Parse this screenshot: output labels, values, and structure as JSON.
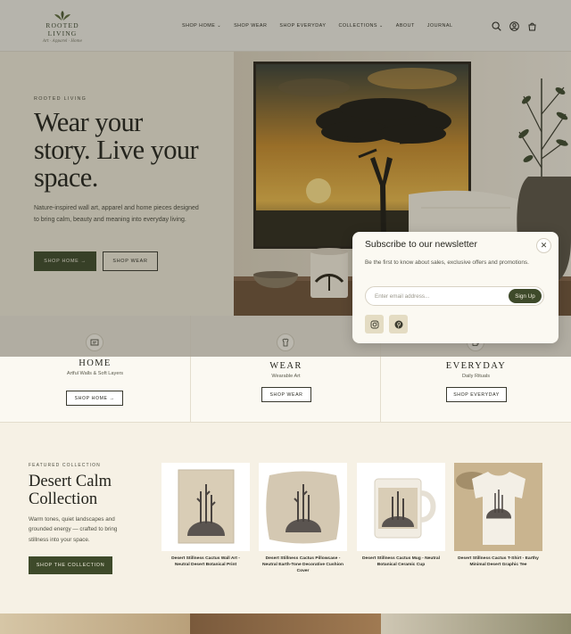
{
  "brand": {
    "name": "ROOTED LIVING",
    "tagline": "Art · Apparel · Home"
  },
  "nav": [
    {
      "label": "SHOP HOME",
      "caret": "⌄"
    },
    {
      "label": "SHOP WEAR",
      "caret": ""
    },
    {
      "label": "SHOP EVERYDAY",
      "caret": ""
    },
    {
      "label": "COLLECTIONS",
      "caret": "⌄"
    },
    {
      "label": "ABOUT",
      "caret": ""
    },
    {
      "label": "JOURNAL",
      "caret": ""
    }
  ],
  "header_icons": [
    "search-icon",
    "account-icon",
    "cart-icon"
  ],
  "hero": {
    "eyebrow": "ROOTED LIVING",
    "title_lines": [
      "Wear your",
      "story. Live your",
      "space."
    ],
    "description": "Nature-inspired wall art, apparel and home pieces designed to bring calm, beauty and meaning into everyday living.",
    "primary_button": "SHOP HOME →",
    "secondary_button": "SHOP WEAR"
  },
  "categories": [
    {
      "title": "HOME",
      "subtitle": "Artful Walls & Soft Layers",
      "button": "SHOP HOME →",
      "icon": "frame-icon"
    },
    {
      "title": "WEAR",
      "subtitle": "Wearable Art",
      "button": "SHOP WEAR",
      "icon": "shirt-icon"
    },
    {
      "title": "EVERYDAY",
      "subtitle": "Daily Rituals",
      "button": "SHOP EVERYDAY",
      "icon": "mug-icon"
    }
  ],
  "featured": {
    "eyebrow": "FEATURED COLLECTION",
    "title_lines": [
      "Desert Calm",
      "Collection"
    ],
    "description": "Warm tones, quiet landscapes and grounded energy — crafted to bring stillness into your space.",
    "button": "SHOP THE COLLECTION",
    "products": [
      {
        "name": "Desert Stillness Cactus Wall Art - Neutral Desert Botanical Print",
        "image": "wall-art-print"
      },
      {
        "name": "Desert Stillness Cactus Pillowcase - Neutral Earth-Tone Decorative Cushion Cover",
        "image": "pillow"
      },
      {
        "name": "Desert Stillness Cactus Mug - Neutral Botanical Ceramic Cup",
        "image": "mug"
      },
      {
        "name": "Desert Stillness Cactus T-Shirt - Earthy Minimal Desert Graphic Tee",
        "image": "t-shirt"
      }
    ]
  },
  "newsletter": {
    "title": "Subscribe to our newsletter",
    "description": "Be the first to know about sales, exclusive offers and promotions.",
    "placeholder": "Enter email address...",
    "button": "Sign Up",
    "close": "✕",
    "social": [
      "instagram-icon",
      "pinterest-icon"
    ]
  },
  "colors": {
    "accent": "#3e4a2a",
    "background": "#f6f1e5",
    "social_tile": "#e4dcc3"
  }
}
